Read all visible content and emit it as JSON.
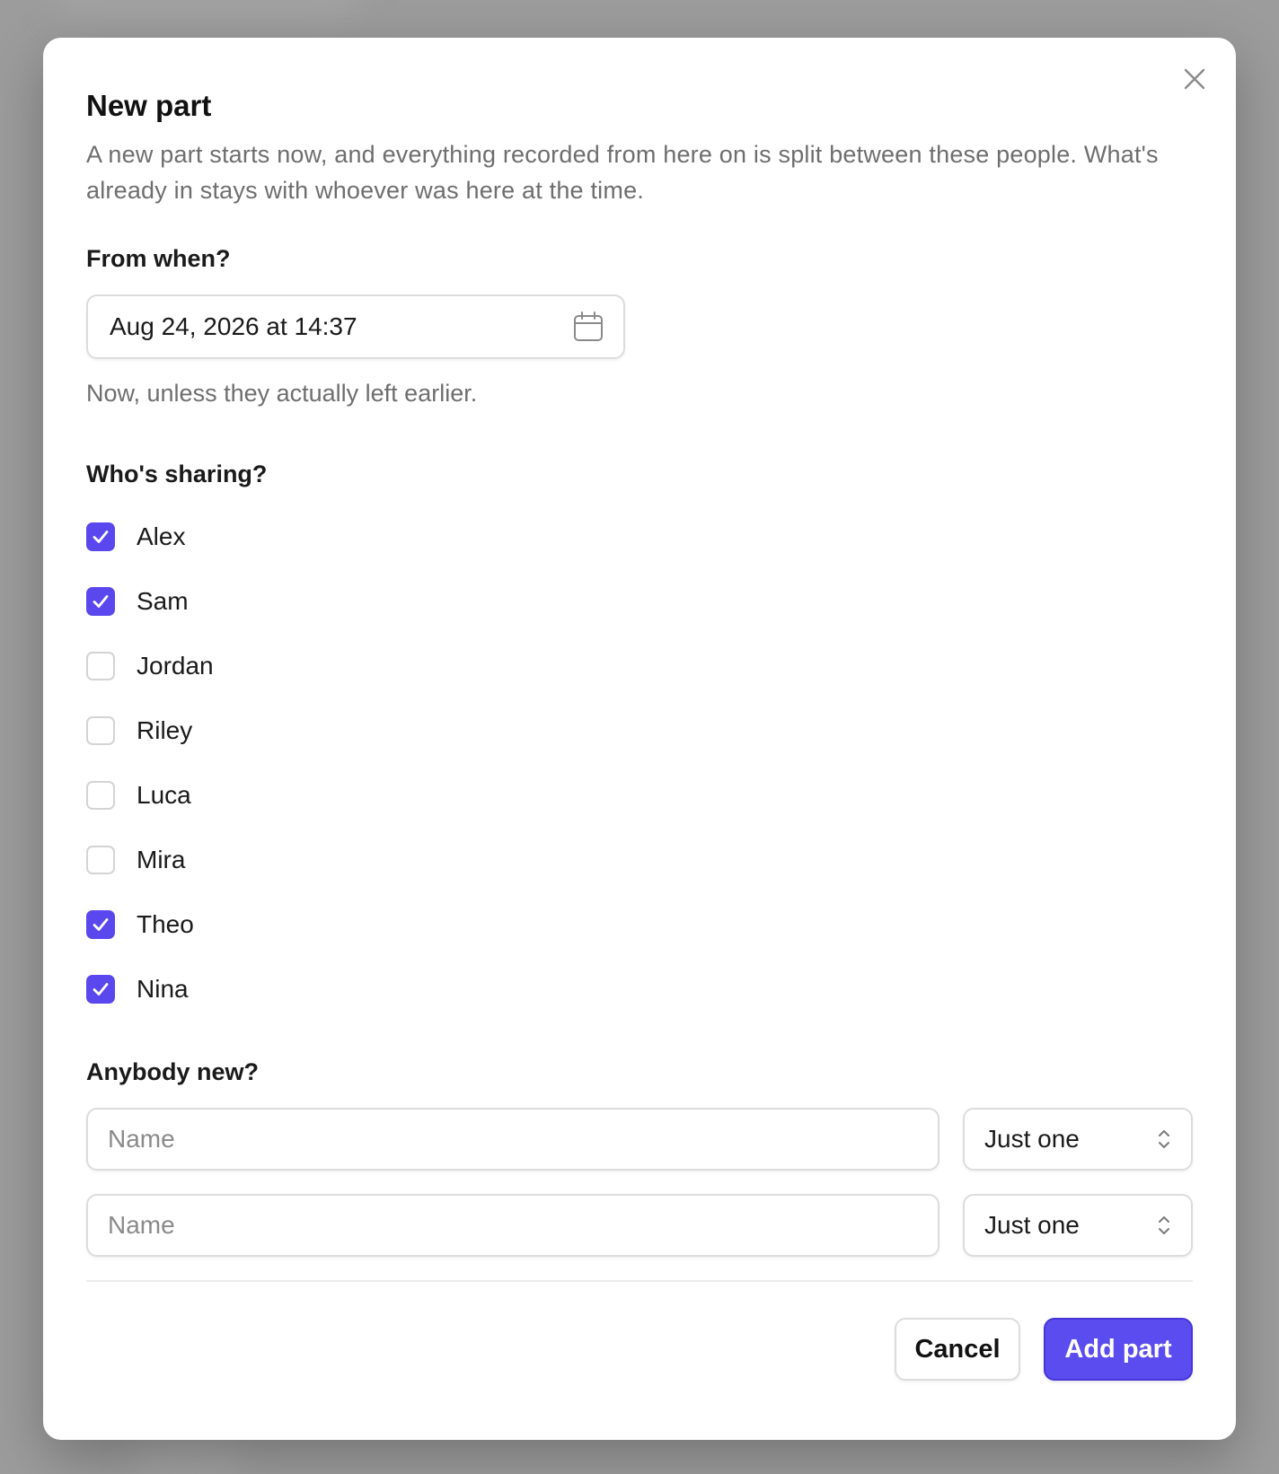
{
  "dialog": {
    "title": "New part",
    "description": "A new part starts now, and everything recorded from here on is split between these people. What's already in stays with whoever was here at the time."
  },
  "when": {
    "label": "From when?",
    "value": "Aug 24, 2026 at 14:37",
    "icon": "calendar-icon",
    "hint": "Now, unless they actually left earlier."
  },
  "sharing": {
    "label": "Who's sharing?",
    "people": [
      {
        "name": "Alex",
        "checked": true
      },
      {
        "name": "Sam",
        "checked": true
      },
      {
        "name": "Jordan",
        "checked": false
      },
      {
        "name": "Riley",
        "checked": false
      },
      {
        "name": "Luca",
        "checked": false
      },
      {
        "name": "Mira",
        "checked": false
      },
      {
        "name": "Theo",
        "checked": true
      },
      {
        "name": "Nina",
        "checked": true
      }
    ]
  },
  "newcomers": {
    "label": "Anybody new?",
    "rows": [
      {
        "placeholder": "Name",
        "value": "",
        "select": "Just one"
      },
      {
        "placeholder": "Name",
        "value": "",
        "select": "Just one"
      }
    ]
  },
  "footer": {
    "cancel_label": "Cancel",
    "submit_label": "Add part"
  },
  "colors": {
    "accent": "#5b4cf0",
    "checkbox_checked": "#5b47ee",
    "muted_text": "#6e6e6e"
  }
}
